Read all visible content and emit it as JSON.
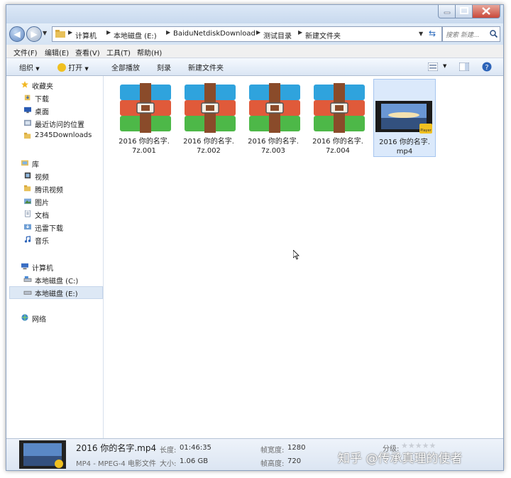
{
  "address": {
    "breadcrumbs": [
      "计算机",
      "本地磁盘 (E:)",
      "BaiduNetdiskDownload",
      "测试目录",
      "新建文件夹"
    ],
    "search_placeholder": "搜索 新建..."
  },
  "menu": [
    "文件(F)",
    "编辑(E)",
    "查看(V)",
    "工具(T)",
    "帮助(H)"
  ],
  "toolbar": {
    "organize": "组织",
    "open": "打开",
    "play_all": "全部播放",
    "burn": "刻录",
    "new_folder": "新建文件夹"
  },
  "sidebar": {
    "favorites": {
      "title": "收藏夹",
      "items": [
        "下载",
        "桌面",
        "最近访问的位置",
        "2345Downloads"
      ]
    },
    "libraries": {
      "title": "库",
      "items": [
        "视频",
        "腾讯视频",
        "图片",
        "文档",
        "迅雷下载",
        "音乐"
      ]
    },
    "computer": {
      "title": "计算机",
      "items": [
        "本地磁盘 (C:)",
        "本地磁盘 (E:)"
      ]
    },
    "network": {
      "title": "网络"
    }
  },
  "files": [
    {
      "line1": "2016 你的名字.",
      "line2": "7z.001",
      "type": "archive"
    },
    {
      "line1": "2016 你的名字.",
      "line2": "7z.002",
      "type": "archive"
    },
    {
      "line1": "2016 你的名字.",
      "line2": "7z.003",
      "type": "archive"
    },
    {
      "line1": "2016 你的名字.",
      "line2": "7z.004",
      "type": "archive"
    },
    {
      "line1": "2016 你的名字.",
      "line2": "mp4",
      "type": "video",
      "selected": true,
      "badge": "Player"
    }
  ],
  "status": {
    "filename": "2016 你的名字.mp4",
    "filetype": "MP4 - MPEG-4 电影文件",
    "duration_label": "长度:",
    "duration": "01:46:35",
    "size_label": "大小:",
    "size": "1.06 GB",
    "width_label": "帧宽度:",
    "width": "1280",
    "height_label": "帧高度:",
    "height": "720",
    "rating_label": "分级:"
  },
  "watermark": "知乎 @传承真理的使者",
  "colors": {
    "selection": "#dbe9fb",
    "archive_blue": "#2fa3dd",
    "archive_red": "#e05a3a",
    "archive_green": "#4db848",
    "strap": "#8a4b2a"
  }
}
